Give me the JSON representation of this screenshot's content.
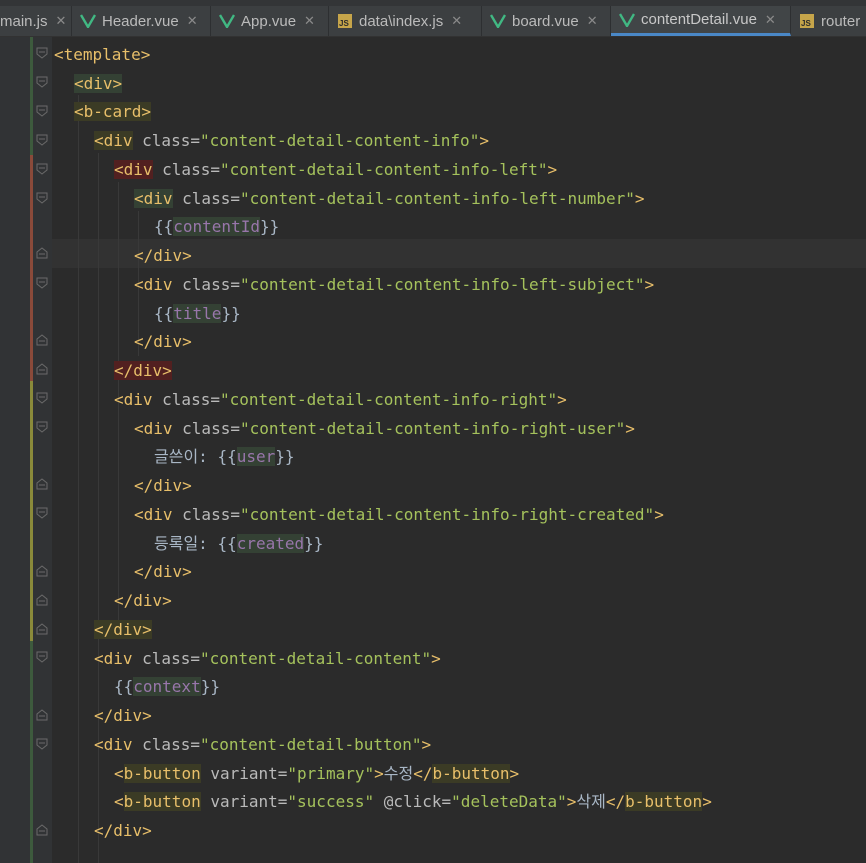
{
  "tabs": [
    {
      "label": "main.js",
      "icon": "js-file-icon",
      "active": false
    },
    {
      "label": "Header.vue",
      "icon": "vue-file-icon",
      "active": false
    },
    {
      "label": "App.vue",
      "icon": "vue-file-icon",
      "active": false
    },
    {
      "label": "data\\index.js",
      "icon": "js-file-icon",
      "active": false
    },
    {
      "label": "board.vue",
      "icon": "vue-file-icon",
      "active": false
    },
    {
      "label": "contentDetail.vue",
      "icon": "vue-file-icon",
      "active": true
    },
    {
      "label": "router",
      "icon": "js-file-icon",
      "active": false
    }
  ],
  "colors": {
    "accent": "#4a88c7",
    "vue": "#41b883",
    "tag": "#e8bf6a",
    "string": "#a5c25c"
  },
  "code": {
    "l1": "<template>",
    "l2": "<div>",
    "l3": "<b-card>",
    "l4_tag": "<div",
    "l4_attr": " class=",
    "l4_str": "\"content-detail-content-info\"",
    "l4_end": ">",
    "l5_tag": "<div",
    "l5_attr": " class=",
    "l5_str": "\"content-detail-content-info-left\"",
    "l5_end": ">",
    "l6_tag": "<div",
    "l6_attr": " class=",
    "l6_str": "\"content-detail-content-info-left-number\"",
    "l6_end": ">",
    "l7_open": "{{",
    "l7_var": "contentId",
    "l7_close": "}}",
    "l8": "</div>",
    "l9_tag": "<div",
    "l9_attr": " class=",
    "l9_str": "\"content-detail-content-info-left-subject\"",
    "l9_end": ">",
    "l10_open": "{{",
    "l10_var": "title",
    "l10_close": "}}",
    "l11": "</div>",
    "l12": "</div>",
    "l13_tag": "<div",
    "l13_attr": " class=",
    "l13_str": "\"content-detail-content-info-right\"",
    "l13_end": ">",
    "l14_tag": "<div",
    "l14_attr": " class=",
    "l14_str": "\"content-detail-content-info-right-user\"",
    "l14_end": ">",
    "l15_text": "글쓴이: ",
    "l15_open": "{{",
    "l15_var": "user",
    "l15_close": "}}",
    "l16": "</div>",
    "l17_tag": "<div",
    "l17_attr": " class=",
    "l17_str": "\"content-detail-content-info-right-created\"",
    "l17_end": ">",
    "l18_text": "등록일: ",
    "l18_open": "{{",
    "l18_var": "created",
    "l18_close": "}}",
    "l19": "</div>",
    "l20": "</div>",
    "l21": "</div>",
    "l22_tag": "<div",
    "l22_attr": " class=",
    "l22_str": "\"content-detail-content\"",
    "l22_end": ">",
    "l23_open": "{{",
    "l23_var": "context",
    "l23_close": "}}",
    "l24": "</div>",
    "l25_tag": "<div",
    "l25_attr": " class=",
    "l25_str": "\"content-detail-button\"",
    "l25_end": ">",
    "l26_lt": "<",
    "l26_tag": "b-button",
    "l26_attr": " variant=",
    "l26_str": "\"primary\"",
    "l26_gt": ">",
    "l26_text": "수정",
    "l26_close_lt": "</",
    "l26_close_tag": "b-button",
    "l26_close_gt": ">",
    "l27_lt": "<",
    "l27_tag": "b-button",
    "l27_attr": " variant=",
    "l27_str": "\"success\"",
    "l27_attr2": " @click=",
    "l27_str2": "\"deleteData\"",
    "l27_gt": ">",
    "l27_text": "삭제",
    "l27_close_lt": "</",
    "l27_close_tag": "b-button",
    "l27_close_gt": ">",
    "l28": "</div>"
  }
}
